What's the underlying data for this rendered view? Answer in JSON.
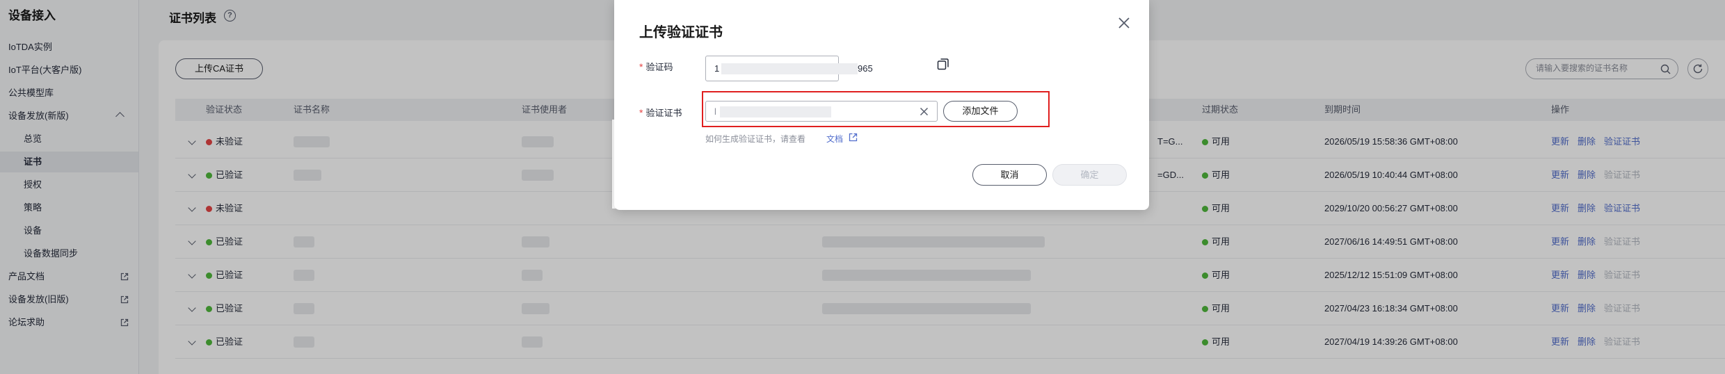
{
  "sidebar": {
    "title": "设备接入",
    "items": [
      {
        "label": "IoTDA实例"
      },
      {
        "label": "IoT平台(大客户版)"
      },
      {
        "label": "公共模型库"
      },
      {
        "label": "设备发放(新版)"
      },
      {
        "label": "总览"
      },
      {
        "label": "证书"
      },
      {
        "label": "授权"
      },
      {
        "label": "策略"
      },
      {
        "label": "设备"
      },
      {
        "label": "设备数据同步"
      },
      {
        "label": "产品文档"
      },
      {
        "label": "设备发放(旧版)"
      },
      {
        "label": "论坛求助"
      }
    ]
  },
  "main": {
    "page_title": "证书列表",
    "upload_ca_button": "上传CA证书",
    "search_placeholder": "请输入要搜索的证书名称",
    "columns": [
      "验证状态",
      "证书名称",
      "证书使用者",
      "过期状态",
      "到期时间",
      "操作"
    ],
    "rows": [
      {
        "status": "未验证",
        "status_color": "#e54545",
        "subject_tail": "T=G...",
        "expiry": "可用",
        "due": "2026/05/19 15:58:36 GMT+08:00",
        "actions": [
          "更新",
          "删除",
          "验证证书"
        ],
        "verify_enabled": true
      },
      {
        "status": "已验证",
        "status_color": "#50b83c",
        "subject_tail": "=GD...",
        "expiry": "可用",
        "due": "2026/05/19 10:40:44 GMT+08:00",
        "actions": [
          "更新",
          "删除",
          "验证证书"
        ],
        "verify_enabled": false
      },
      {
        "status": "未验证",
        "status_color": "#e54545",
        "subject_tail": "",
        "expiry": "可用",
        "due": "2029/10/20 00:56:27 GMT+08:00",
        "actions": [
          "更新",
          "删除",
          "验证证书"
        ],
        "verify_enabled": true
      },
      {
        "status": "已验证",
        "status_color": "#50b83c",
        "subject_tail": "",
        "expiry": "可用",
        "due": "2027/06/16 14:49:51 GMT+08:00",
        "actions": [
          "更新",
          "删除",
          "验证证书"
        ],
        "verify_enabled": false
      },
      {
        "status": "已验证",
        "status_color": "#50b83c",
        "subject_tail": "",
        "expiry": "可用",
        "due": "2025/12/12 15:51:09 GMT+08:00",
        "actions": [
          "更新",
          "删除",
          "验证证书"
        ],
        "verify_enabled": false
      },
      {
        "status": "已验证",
        "status_color": "#50b83c",
        "subject_tail": "",
        "expiry": "可用",
        "due": "2027/04/23 16:18:34 GMT+08:00",
        "actions": [
          "更新",
          "删除",
          "验证证书"
        ],
        "verify_enabled": false
      },
      {
        "status": "已验证",
        "status_color": "#50b83c",
        "subject_tail": "",
        "expiry": "可用",
        "due": "2027/04/19 14:39:26 GMT+08:00",
        "actions": [
          "更新",
          "删除",
          "验证证书"
        ],
        "verify_enabled": false
      }
    ]
  },
  "dialog": {
    "title": "上传验证证书",
    "code_label": "验证码",
    "code_value_start": "1",
    "code_value_end": "965",
    "cert_label": "验证证书",
    "cert_value_start": "l",
    "add_file_button": "添加文件",
    "hint": "如何生成验证证书，请查看",
    "doc_link": "文档",
    "cancel_button": "取消",
    "ok_button": "确定",
    "required_mark": "*"
  },
  "colors": {
    "accent": "#526ecc",
    "highlight_frame": "#e01f1f",
    "verified": "#50b83c",
    "unverified": "#e54545"
  }
}
